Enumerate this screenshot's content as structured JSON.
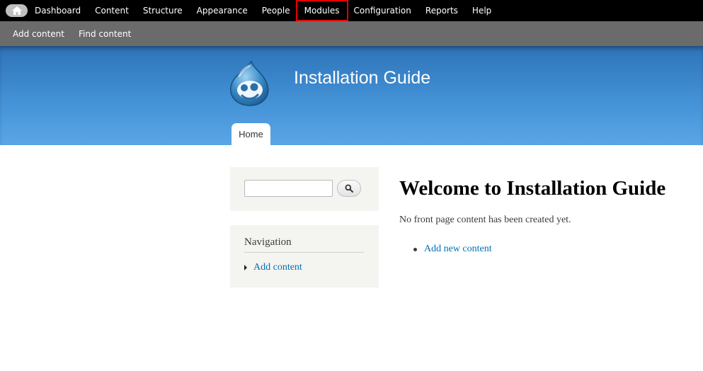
{
  "toolbar": {
    "home_icon": "home-icon",
    "items": [
      {
        "label": "Dashboard"
      },
      {
        "label": "Content"
      },
      {
        "label": "Structure"
      },
      {
        "label": "Appearance"
      },
      {
        "label": "People"
      },
      {
        "label": "Modules",
        "highlighted": true
      },
      {
        "label": "Configuration"
      },
      {
        "label": "Reports"
      },
      {
        "label": "Help"
      }
    ],
    "highlight_color": "#e60000"
  },
  "shortcuts": [
    {
      "label": "Add content"
    },
    {
      "label": "Find content"
    }
  ],
  "header": {
    "site_name": "Installation Guide",
    "logo_icon": "drupal-drop-logo",
    "tabs": [
      {
        "label": "Home"
      }
    ],
    "colors": {
      "top": "#2e73b8",
      "bottom": "#5aa6e6"
    }
  },
  "sidebar": {
    "search": {
      "value": "",
      "button_icon": "search-icon"
    },
    "navigation": {
      "title": "Navigation",
      "links": [
        {
          "label": "Add content"
        }
      ]
    }
  },
  "main": {
    "title": "Welcome to Installation Guide",
    "message": "No front page content has been created yet.",
    "links": [
      {
        "label": "Add new content"
      }
    ]
  },
  "colors": {
    "link": "#0071b3",
    "toolbar": "#000000",
    "shortcut_bar": "#6b6b6b",
    "sidebar_bg": "#f4f4f1"
  }
}
